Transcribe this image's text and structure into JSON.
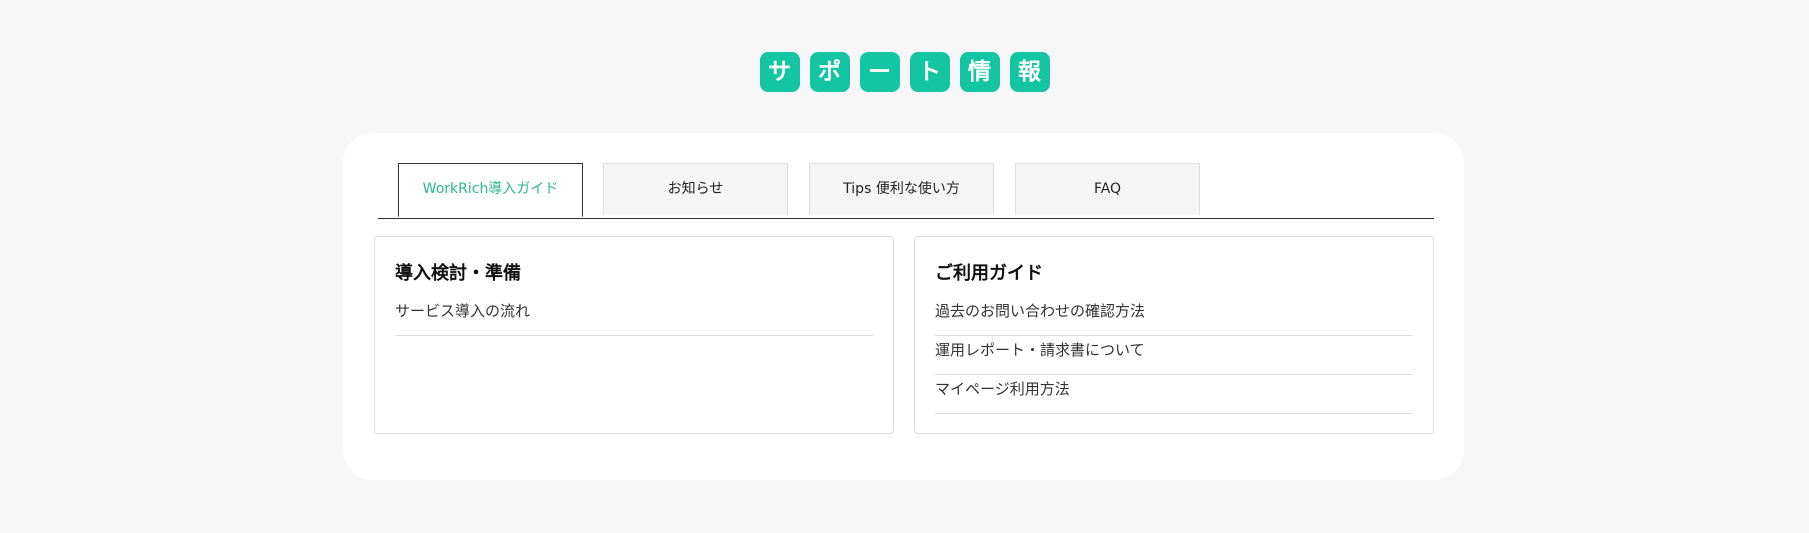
{
  "title_chars": [
    "サ",
    "ポ",
    "ー",
    "ト",
    "情",
    "報"
  ],
  "colors": {
    "accent": "#14c5a3",
    "active_tab_text": "#2bb88f",
    "background": "#f7f7f7"
  },
  "tabs": [
    {
      "label": "WorkRich導入ガイド",
      "active": true
    },
    {
      "label": "お知らせ",
      "active": false
    },
    {
      "label": "Tips 便利な使い方",
      "active": false
    },
    {
      "label": "FAQ",
      "active": false
    }
  ],
  "panels": [
    {
      "heading": "導入検討・準備",
      "items": [
        "サービス導入の流れ"
      ]
    },
    {
      "heading": "ご利用ガイド",
      "items": [
        "過去のお問い合わせの確認方法",
        "運用レポート・請求書について",
        "マイページ利用方法"
      ]
    }
  ]
}
